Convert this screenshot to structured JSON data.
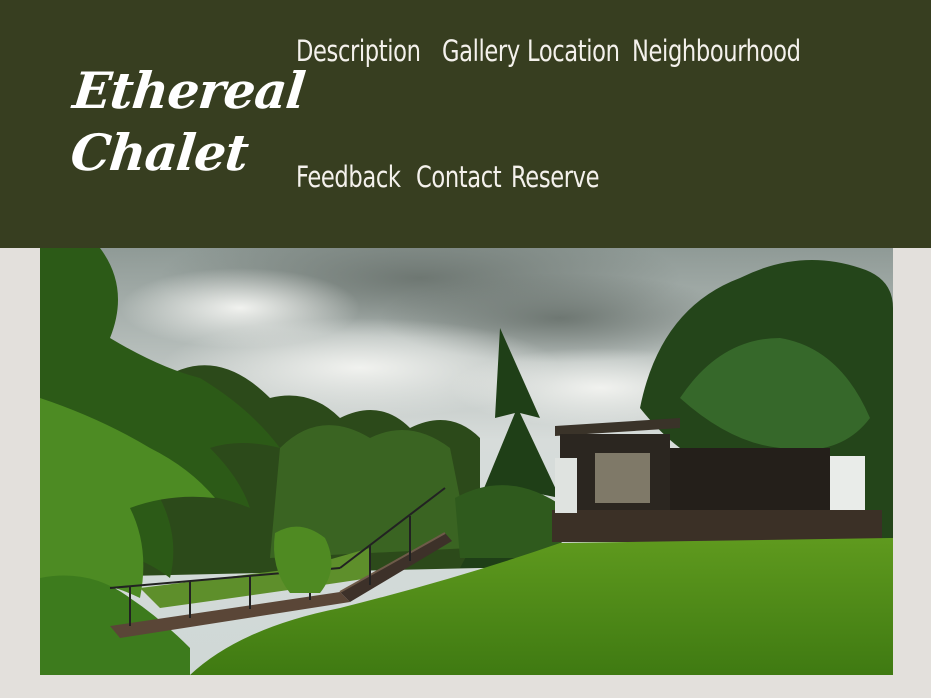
{
  "brand": {
    "line1": "Ethereal",
    "line2": "Chalet"
  },
  "nav": {
    "items": [
      {
        "label": "Description"
      },
      {
        "label": "Gallery"
      },
      {
        "label": "Location"
      },
      {
        "label": "Neighbourhood"
      },
      {
        "label": "Feedback"
      },
      {
        "label": "Contact"
      },
      {
        "label": "Reserve"
      }
    ]
  },
  "colors": {
    "header_bg": "#373e20",
    "page_bg": "#e3e0dc",
    "nav_text": "#f4f1ec"
  },
  "hero": {
    "image_subject": "chalet-garden-photo"
  }
}
